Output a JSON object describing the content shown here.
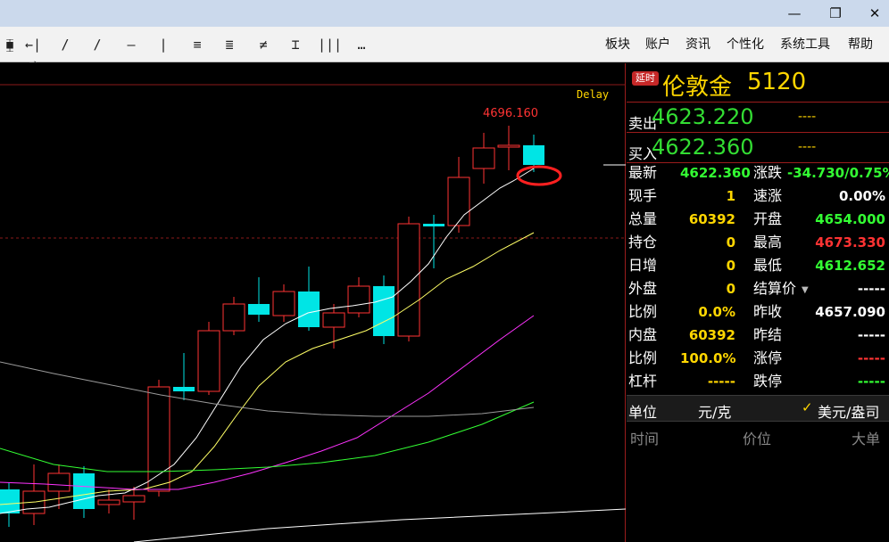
{
  "window": {
    "min": "—",
    "restore": "❐",
    "close": "✕"
  },
  "toolbar": {
    "tools": [
      "⧯",
      "←|→",
      "/",
      "∕",
      "—",
      "|",
      "≡",
      "≣",
      "≠",
      "⌶",
      "|||",
      "…"
    ],
    "menu": [
      "板块",
      "账户",
      "资讯",
      "个性化",
      "系统工具",
      "帮助"
    ]
  },
  "chart": {
    "delay_label": "Delay",
    "high_label": "4696.160",
    "colors": {
      "up": "#ff3333",
      "down": "#00e5e5",
      "ma5": "#ffffff",
      "ma10": "#ffff66",
      "ma20": "#ff33ff",
      "ma60": "#33ff33",
      "grid": "#8b1a1a"
    }
  },
  "quote": {
    "badge": "延时",
    "name": "伦敦金",
    "code": "5120",
    "sell": {
      "label": "卖出",
      "price": "4623.220",
      "vol": "----"
    },
    "buy": {
      "label": "买入",
      "price": "4622.360",
      "vol": "----"
    },
    "stats": [
      {
        "l": "最新",
        "v": "4622.360",
        "c": "#33ff33",
        "l2": "涨跌",
        "v2": "-34.730/0.75%",
        "c2": "#33ff33"
      },
      {
        "l": "现手",
        "v": "1",
        "c": "#ffd600",
        "l2": "速涨",
        "v2": "0.00%",
        "c2": "#ffffff"
      },
      {
        "l": "总量",
        "v": "60392",
        "c": "#ffd600",
        "l2": "开盘",
        "v2": "4654.000",
        "c2": "#33ff33"
      },
      {
        "l": "持仓",
        "v": "0",
        "c": "#ffd600",
        "l2": "最高",
        "v2": "4673.330",
        "c2": "#ff3333"
      },
      {
        "l": "日增",
        "v": "0",
        "c": "#ffd600",
        "l2": "最低",
        "v2": "4612.652",
        "c2": "#33ff33"
      },
      {
        "l": "外盘",
        "v": "0",
        "c": "#ffd600",
        "l2": "结算价",
        "v2": "-----",
        "c2": "#ffffff"
      },
      {
        "l": "比例",
        "v": "0.0%",
        "c": "#ffd600",
        "l2": "昨收",
        "v2": "4657.090",
        "c2": "#ffffff"
      },
      {
        "l": "内盘",
        "v": "60392",
        "c": "#ffd600",
        "l2": "昨结",
        "v2": "-----",
        "c2": "#ffffff"
      },
      {
        "l": "比例",
        "v": "100.0%",
        "c": "#ffd600",
        "l2": "涨停",
        "v2": "-----",
        "c2": "#ff3333"
      },
      {
        "l": "杠杆",
        "v": "-----",
        "c": "#ffd600",
        "l2": "跌停",
        "v2": "-----",
        "c2": "#33ff33"
      }
    ],
    "unit_label": "单位",
    "unit_value": "元/克",
    "currency": "美元/盎司",
    "tick_headers": [
      "时间",
      "价位",
      "大单"
    ]
  }
}
